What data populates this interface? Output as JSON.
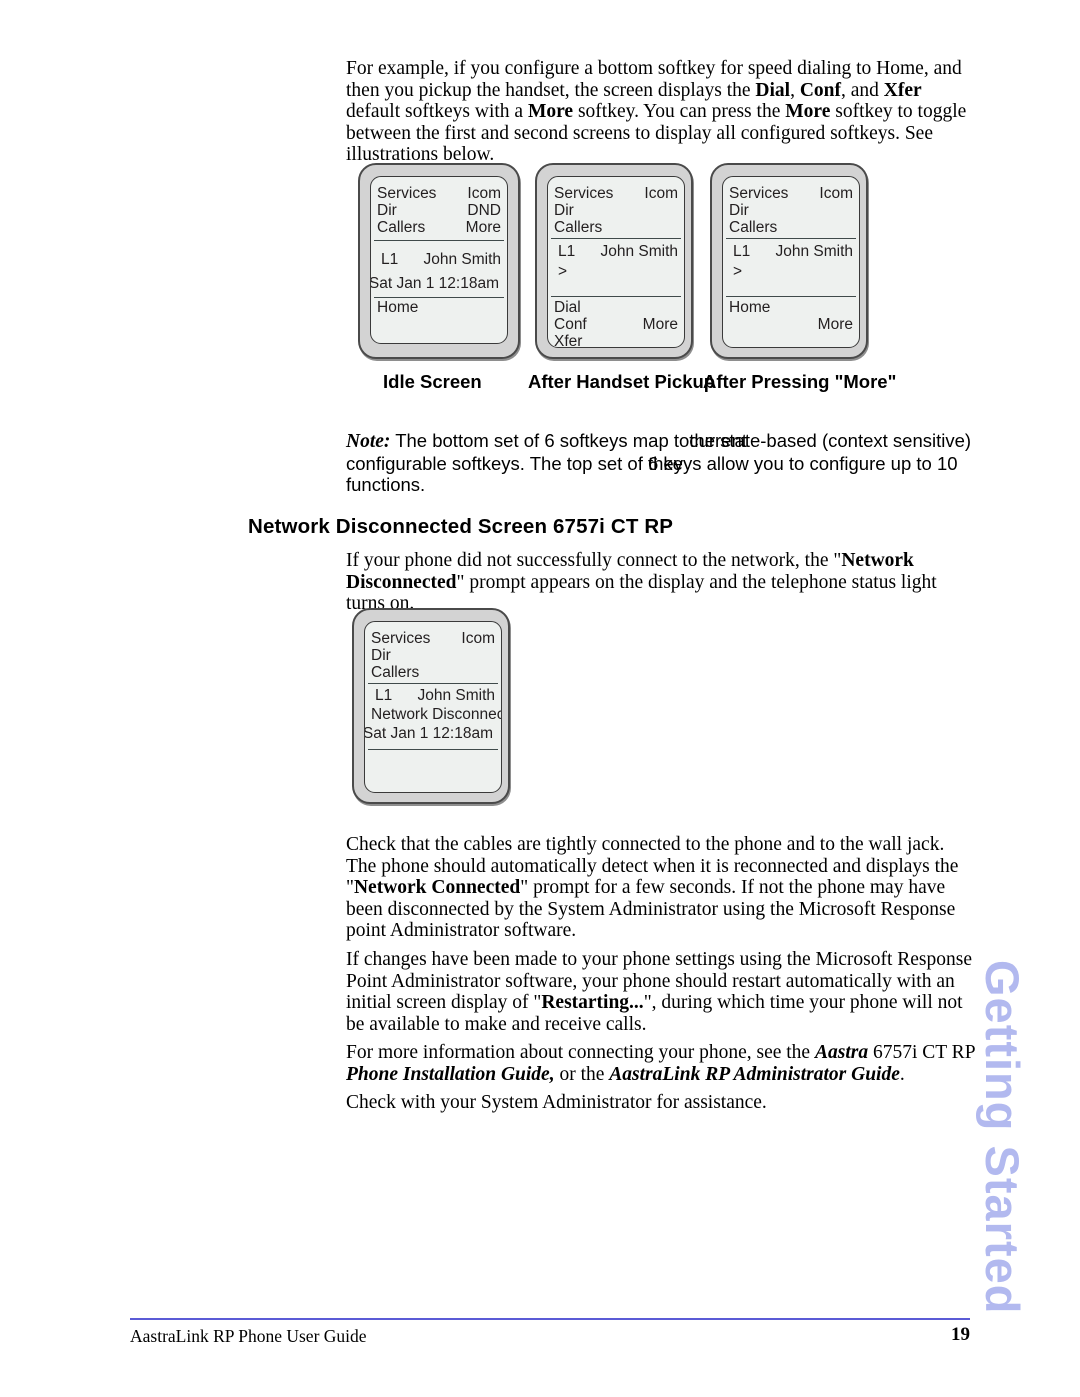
{
  "intro_paragraph": {
    "segments": [
      {
        "t": "For example, if you configure a bottom softkey for speed dialing to Home, and then you pickup the handset, the screen displays the "
      },
      {
        "t": "Dial",
        "b": true
      },
      {
        "t": ", "
      },
      {
        "t": "Conf",
        "b": true
      },
      {
        "t": ", and "
      },
      {
        "t": "Xfer",
        "b": true
      },
      {
        "t": " default softkeys with a "
      },
      {
        "t": "More",
        "b": true
      },
      {
        "t": " softkey. You can press the "
      },
      {
        "t": "More",
        "b": true
      },
      {
        "t": " softkey to toggle between the first and second screens to display all configured softkeys. See illustrations below."
      }
    ]
  },
  "phone_screens": [
    {
      "caption": "Idle Screen",
      "rows": {
        "softkey_left_1": "Services",
        "softkey_right_1": "Icom",
        "softkey_left_2": "Dir",
        "softkey_right_2": "DND",
        "softkey_left_3": "Callers",
        "softkey_right_3": "More",
        "line_label": "L1",
        "caller_name": "John Smith",
        "datetime": "Sat  Jan 1  12:18am",
        "bottom_left_1": "Home",
        "bottom_right_2": ""
      }
    },
    {
      "caption": "After Handset Pickup",
      "rows": {
        "softkey_left_1": "Services",
        "softkey_right_1": "Icom",
        "softkey_left_2": "Dir",
        "softkey_right_2": "",
        "softkey_left_3": "Callers",
        "softkey_right_3": "",
        "line_label": "L1",
        "caller_name": "John Smith",
        "prompt": ">",
        "bottom_left_1": "Dial",
        "bottom_left_2": "Conf",
        "bottom_left_3": "Xfer",
        "bottom_right_2": "More"
      }
    },
    {
      "caption": "After Pressing \"More\"",
      "rows": {
        "softkey_left_1": "Services",
        "softkey_right_1": "Icom",
        "softkey_left_2": "Dir",
        "softkey_right_2": "",
        "softkey_left_3": "Callers",
        "softkey_right_3": "",
        "line_label": "L1",
        "caller_name": "John Smith",
        "prompt": ">",
        "bottom_left_1": "Home",
        "bottom_right_2": "More"
      }
    }
  ],
  "note": {
    "label": "Note:",
    "line1_a": " The bottom set of 6 softkeys map to",
    "line1_overlap_under": " the",
    "line1_overlap_over": "current",
    "line1_b": " state-based (context sensitive)",
    "line2_a": "configurable softkeys. The top set of ",
    "line2_overlap_under": "6 keys",
    "line2_overlap_over": "they",
    "line2_b": " allow you to configure up to 10",
    "line3": "functions."
  },
  "heading": "Network Disconnected Screen 6757i CT RP",
  "disconnect_paragraph": {
    "segments": [
      {
        "t": "If your phone did not successfully connect to the network, the \""
      },
      {
        "t": "Network Disconnected",
        "b": true
      },
      {
        "t": "\" prompt appears on the display and the telephone status light turns on."
      }
    ]
  },
  "disconnect_screen": {
    "softkey_left_1": "Services",
    "softkey_right_1": "Icom",
    "softkey_left_2": "Dir",
    "softkey_left_3": "Callers",
    "line_label": "L1",
    "caller_name": "John Smith",
    "status_message": "Network Disconnected",
    "datetime": "Sat  Jan 1  12:18am"
  },
  "body_paragraphs": [
    {
      "segments": [
        {
          "t": "Check that the cables are tightly connected to the phone and to the wall jack. The phone should automatically detect when it is reconnected and displays the \""
        },
        {
          "t": "Network Connected",
          "b": true
        },
        {
          "t": "\" prompt for a few seconds. If not the phone may have been disconnected by the System Administrator using the Microsoft Response point Administrator software."
        }
      ]
    },
    {
      "segments": [
        {
          "t": "If changes have been made to your phone settings using the Microsoft Response Point Administrator software, your phone should restart automatically with an initial screen display of \""
        },
        {
          "t": "Restarting...",
          "b": true
        },
        {
          "t": "\", during which time your phone will not be available to make and receive calls."
        }
      ]
    },
    {
      "segments": [
        {
          "t": "For more information about connecting your phone, see the "
        },
        {
          "t": "Aastra",
          "b": true,
          "i": true
        },
        {
          "t": " 6757i CT RP "
        },
        {
          "t": "Phone Installation Guide,",
          "b": true,
          "i": true
        },
        {
          "t": " or the "
        },
        {
          "t": "AastraLink RP Administrator Guide",
          "b": true,
          "i": true
        },
        {
          "t": "."
        }
      ]
    },
    {
      "segments": [
        {
          "t": "Check with your System Administrator for assistance."
        }
      ]
    }
  ],
  "side_tab": "Getting Started",
  "footer": {
    "left": "AastraLink RP Phone User Guide",
    "page_number": "19"
  },
  "colors": {
    "side_tab": "#b2b9ef",
    "footer_rule": "#5b5bd6",
    "phone_bezel": "#d3d3d3",
    "phone_screen": "#eef1ef"
  }
}
